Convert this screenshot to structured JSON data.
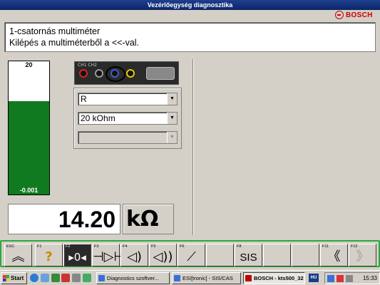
{
  "window": {
    "title": "Vezérlőegység diagnosztika",
    "brand": "BOSCH"
  },
  "info": {
    "line1": "1-csatornás multiméter",
    "line2": "Kilépés a multiméterből a <<-val."
  },
  "bar_gauge": {
    "top_label": "20",
    "bottom_label": "-0.001",
    "fill_fraction": 0.7,
    "fill_color": "#0f7a20"
  },
  "selectors": {
    "mode": {
      "value": "R"
    },
    "range": {
      "value": "20  kOhm"
    },
    "third": {
      "value": "",
      "disabled": true
    }
  },
  "readout": {
    "value": "14.20",
    "unit": "kΩ"
  },
  "fkeys": [
    {
      "key": "ESC",
      "icon": "double-chevron-up-icon",
      "glyph": "︽"
    },
    {
      "key": "F1",
      "icon": "help-icon",
      "glyph": "?"
    },
    {
      "key": "F2",
      "icon": "resistance-probe-icon",
      "glyph": "▸0◂",
      "active": true
    },
    {
      "key": "F3",
      "icon": "diode-test-icon",
      "glyph": "⊣▷⊢"
    },
    {
      "key": "F4",
      "icon": "sound-wave-icon",
      "glyph": "◁)"
    },
    {
      "key": "F5",
      "icon": "sound-wave-icon-2",
      "glyph": "◁))"
    },
    {
      "key": "F6",
      "icon": "graph-icon",
      "glyph": "⟋"
    },
    {
      "key": "",
      "icon": "blank",
      "glyph": ""
    },
    {
      "key": "F8",
      "icon": "sis-text-icon",
      "glyph": "SIS",
      "text": true
    },
    {
      "key": "",
      "icon": "blank",
      "glyph": ""
    },
    {
      "key": "",
      "icon": "blank",
      "glyph": ""
    },
    {
      "key": "F11",
      "icon": "double-chevron-left-icon",
      "glyph": "《"
    },
    {
      "key": "F12",
      "icon": "double-chevron-right-icon",
      "glyph": "》",
      "disabled": true
    }
  ],
  "taskbar": {
    "start": "Start",
    "tasks": [
      {
        "label": "Diagnostics szoftver...",
        "icon_color": "#3a6fd8"
      },
      {
        "label": "ESI[tronic] - SIS/CAS",
        "icon_color": "#3a6fd8"
      },
      {
        "label": "BOSCH - kts500_32",
        "icon_color": "#c00000",
        "active": true
      }
    ],
    "lang": "HU",
    "clock": "15:33"
  }
}
